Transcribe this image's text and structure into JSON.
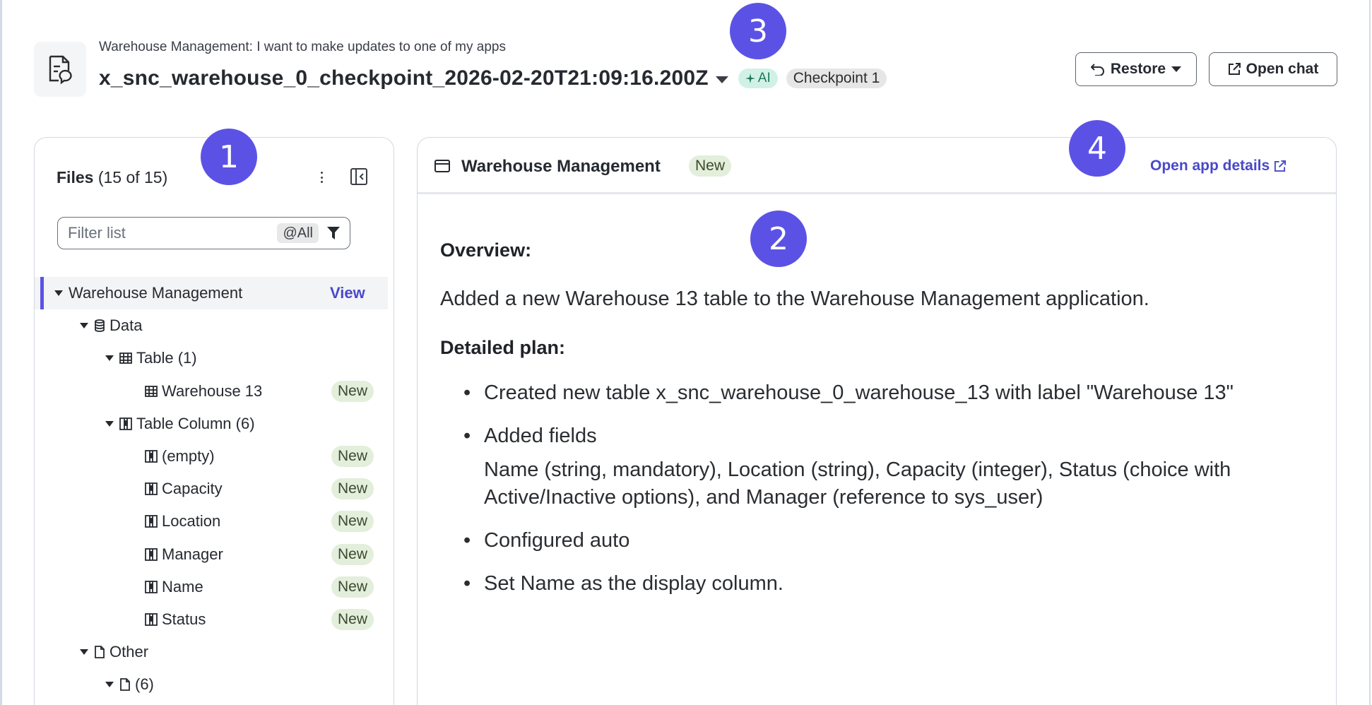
{
  "header": {
    "breadcrumb": "Warehouse Management: I want to make updates to one of my apps",
    "title": "x_snc_warehouse_0_checkpoint_2026-02-20T21:09:16.200Z",
    "ai_badge": "AI",
    "checkpoint_badge": "Checkpoint 1",
    "restore_label": "Restore",
    "open_chat_label": "Open chat"
  },
  "callouts": [
    "1",
    "2",
    "3",
    "4"
  ],
  "files": {
    "title_bold": "Files",
    "title_count": "(15 of 15)",
    "filter_placeholder": "Filter list",
    "filter_scope": "@All",
    "tree": [
      {
        "label": "Warehouse Management",
        "action": "View",
        "level": 0,
        "caret": true,
        "icon": "none-icon",
        "selected": true
      },
      {
        "label": "Data",
        "level": 1,
        "caret": true,
        "icon": "database-icon"
      },
      {
        "label": "Table (1)",
        "level": 2,
        "caret": true,
        "icon": "table-icon"
      },
      {
        "label": "Warehouse 13",
        "level": 3,
        "caret": false,
        "icon": "table-icon",
        "badge": "New"
      },
      {
        "label": "Table Column (6)",
        "level": 2,
        "caret": true,
        "icon": "column-icon"
      },
      {
        "label": "(empty)",
        "level": 3,
        "caret": false,
        "icon": "column-icon",
        "badge": "New"
      },
      {
        "label": "Capacity",
        "level": 3,
        "caret": false,
        "icon": "column-icon",
        "badge": "New"
      },
      {
        "label": "Location",
        "level": 3,
        "caret": false,
        "icon": "column-icon",
        "badge": "New"
      },
      {
        "label": "Manager",
        "level": 3,
        "caret": false,
        "icon": "column-icon",
        "badge": "New"
      },
      {
        "label": "Name",
        "level": 3,
        "caret": false,
        "icon": "column-icon",
        "badge": "New"
      },
      {
        "label": "Status",
        "level": 3,
        "caret": false,
        "icon": "column-icon",
        "badge": "New"
      },
      {
        "label": "Other",
        "level": 1,
        "caret": true,
        "icon": "file-icon"
      },
      {
        "label": " (6)",
        "level": 2,
        "caret": true,
        "icon": "file-icon"
      }
    ]
  },
  "detail": {
    "title": "Warehouse Management",
    "badge": "New",
    "open_details": "Open app details",
    "overview_heading": "Overview:",
    "overview_text": "Added a new Warehouse 13 table to the Warehouse Management application.",
    "plan_heading": "Detailed plan:",
    "plan_items": [
      {
        "text": "Created new table x_snc_warehouse_0_warehouse_13 with label \"Warehouse 13\""
      },
      {
        "text": "Added fields",
        "sub": "Name (string, mandatory), Location (string), Capacity (integer), Status (choice with Active/Inactive options), and Manager (reference to sys_user)"
      },
      {
        "text": "Configured auto"
      },
      {
        "text": "Set Name as the display column."
      }
    ]
  }
}
